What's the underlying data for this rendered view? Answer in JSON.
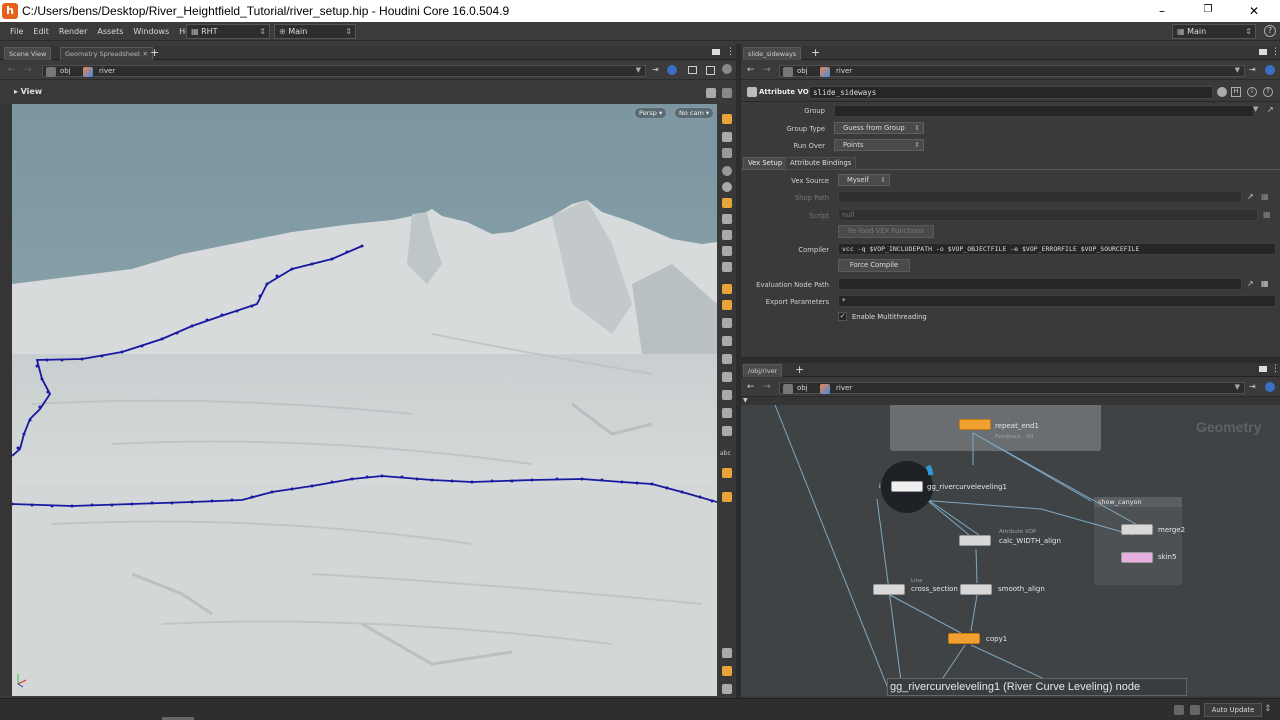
{
  "window": {
    "title": "C:/Users/bens/Desktop/River_Heightfield_Tutorial/river_setup.hip - Houdini Core 16.0.504.9",
    "logo_letter": "h",
    "minimize": "–",
    "maximize": "❐",
    "close": "✕"
  },
  "menu": {
    "items": [
      "File",
      "Edit",
      "Render",
      "Assets",
      "Windows",
      "Help"
    ],
    "shelf_set": "RHT",
    "desktop_left": "Main",
    "desktop_right": "Main",
    "help_icon": "?"
  },
  "left_pane": {
    "tabs": [
      "Scene View",
      "Geometry Spreadsheet"
    ],
    "add_tab": "+",
    "path_root": "obj",
    "path_node": "river",
    "view_label": "View",
    "persp_button": "Persp ▾",
    "cam_button": "No cam ▾"
  },
  "param_pane": {
    "tab": "slide_sideways",
    "add_tab": "+",
    "path_root": "obj",
    "path_node": "river",
    "node_type": "Attribute VOP",
    "node_name": "slide_sideways",
    "group_label": "Group",
    "group_value": "",
    "group_type_label": "Group Type",
    "group_type_value": "Guess from Group",
    "run_over_label": "Run Over",
    "run_over_value": "Points",
    "subtabs": [
      "Vex Setup",
      "Attribute Bindings"
    ],
    "vex_source_label": "Vex Source",
    "vex_source_value": "Myself",
    "shop_path_label": "Shop Path",
    "script_label": "Script",
    "script_value": "null",
    "reload_button": "Re-load VEX Functions",
    "compiler_label": "Compiler",
    "compiler_value": "vcc -q $VOP_INCLUDEPATH -o $VOP_OBJECTFILE -e $VOP_ERRORFILE $VOP_SOURCEFILE",
    "force_compile_button": "Force Compile",
    "eval_node_path_label": "Evaluation Node Path",
    "export_params_label": "Export Parameters",
    "export_params_value": "*",
    "multithread_label": "Enable Multithreading"
  },
  "network_pane": {
    "tab": "/obj/river",
    "add_tab": "+",
    "path_root": "obj",
    "path_node": "river",
    "context_label": "Geometry",
    "network_box_label": "show_canyon",
    "nodes": {
      "repeat_end": {
        "name": "repeat_end1",
        "sub": "Feedback · 60"
      },
      "leveling": {
        "name": "gg_rivercurveleveling1"
      },
      "calc_width": {
        "name": "calc_WIDTH_align",
        "sub": "Attribute VOP"
      },
      "smooth": {
        "name": "smooth_align"
      },
      "cross": {
        "name": "cross_section",
        "sub": "Line"
      },
      "copy": {
        "name": "copy1"
      },
      "merge": {
        "name": "merge2"
      },
      "skin": {
        "name": "skin5"
      }
    },
    "info_text": "gg_rivercurveleveling1 (River Curve Leveling) node"
  },
  "status": {
    "auto_update": "Auto Update"
  },
  "colors": {
    "houdini_orange": "#e2621b",
    "curve_blue": "#1a1aa8",
    "sky": "#7f99a3",
    "terrain": "#d2d6d6"
  }
}
